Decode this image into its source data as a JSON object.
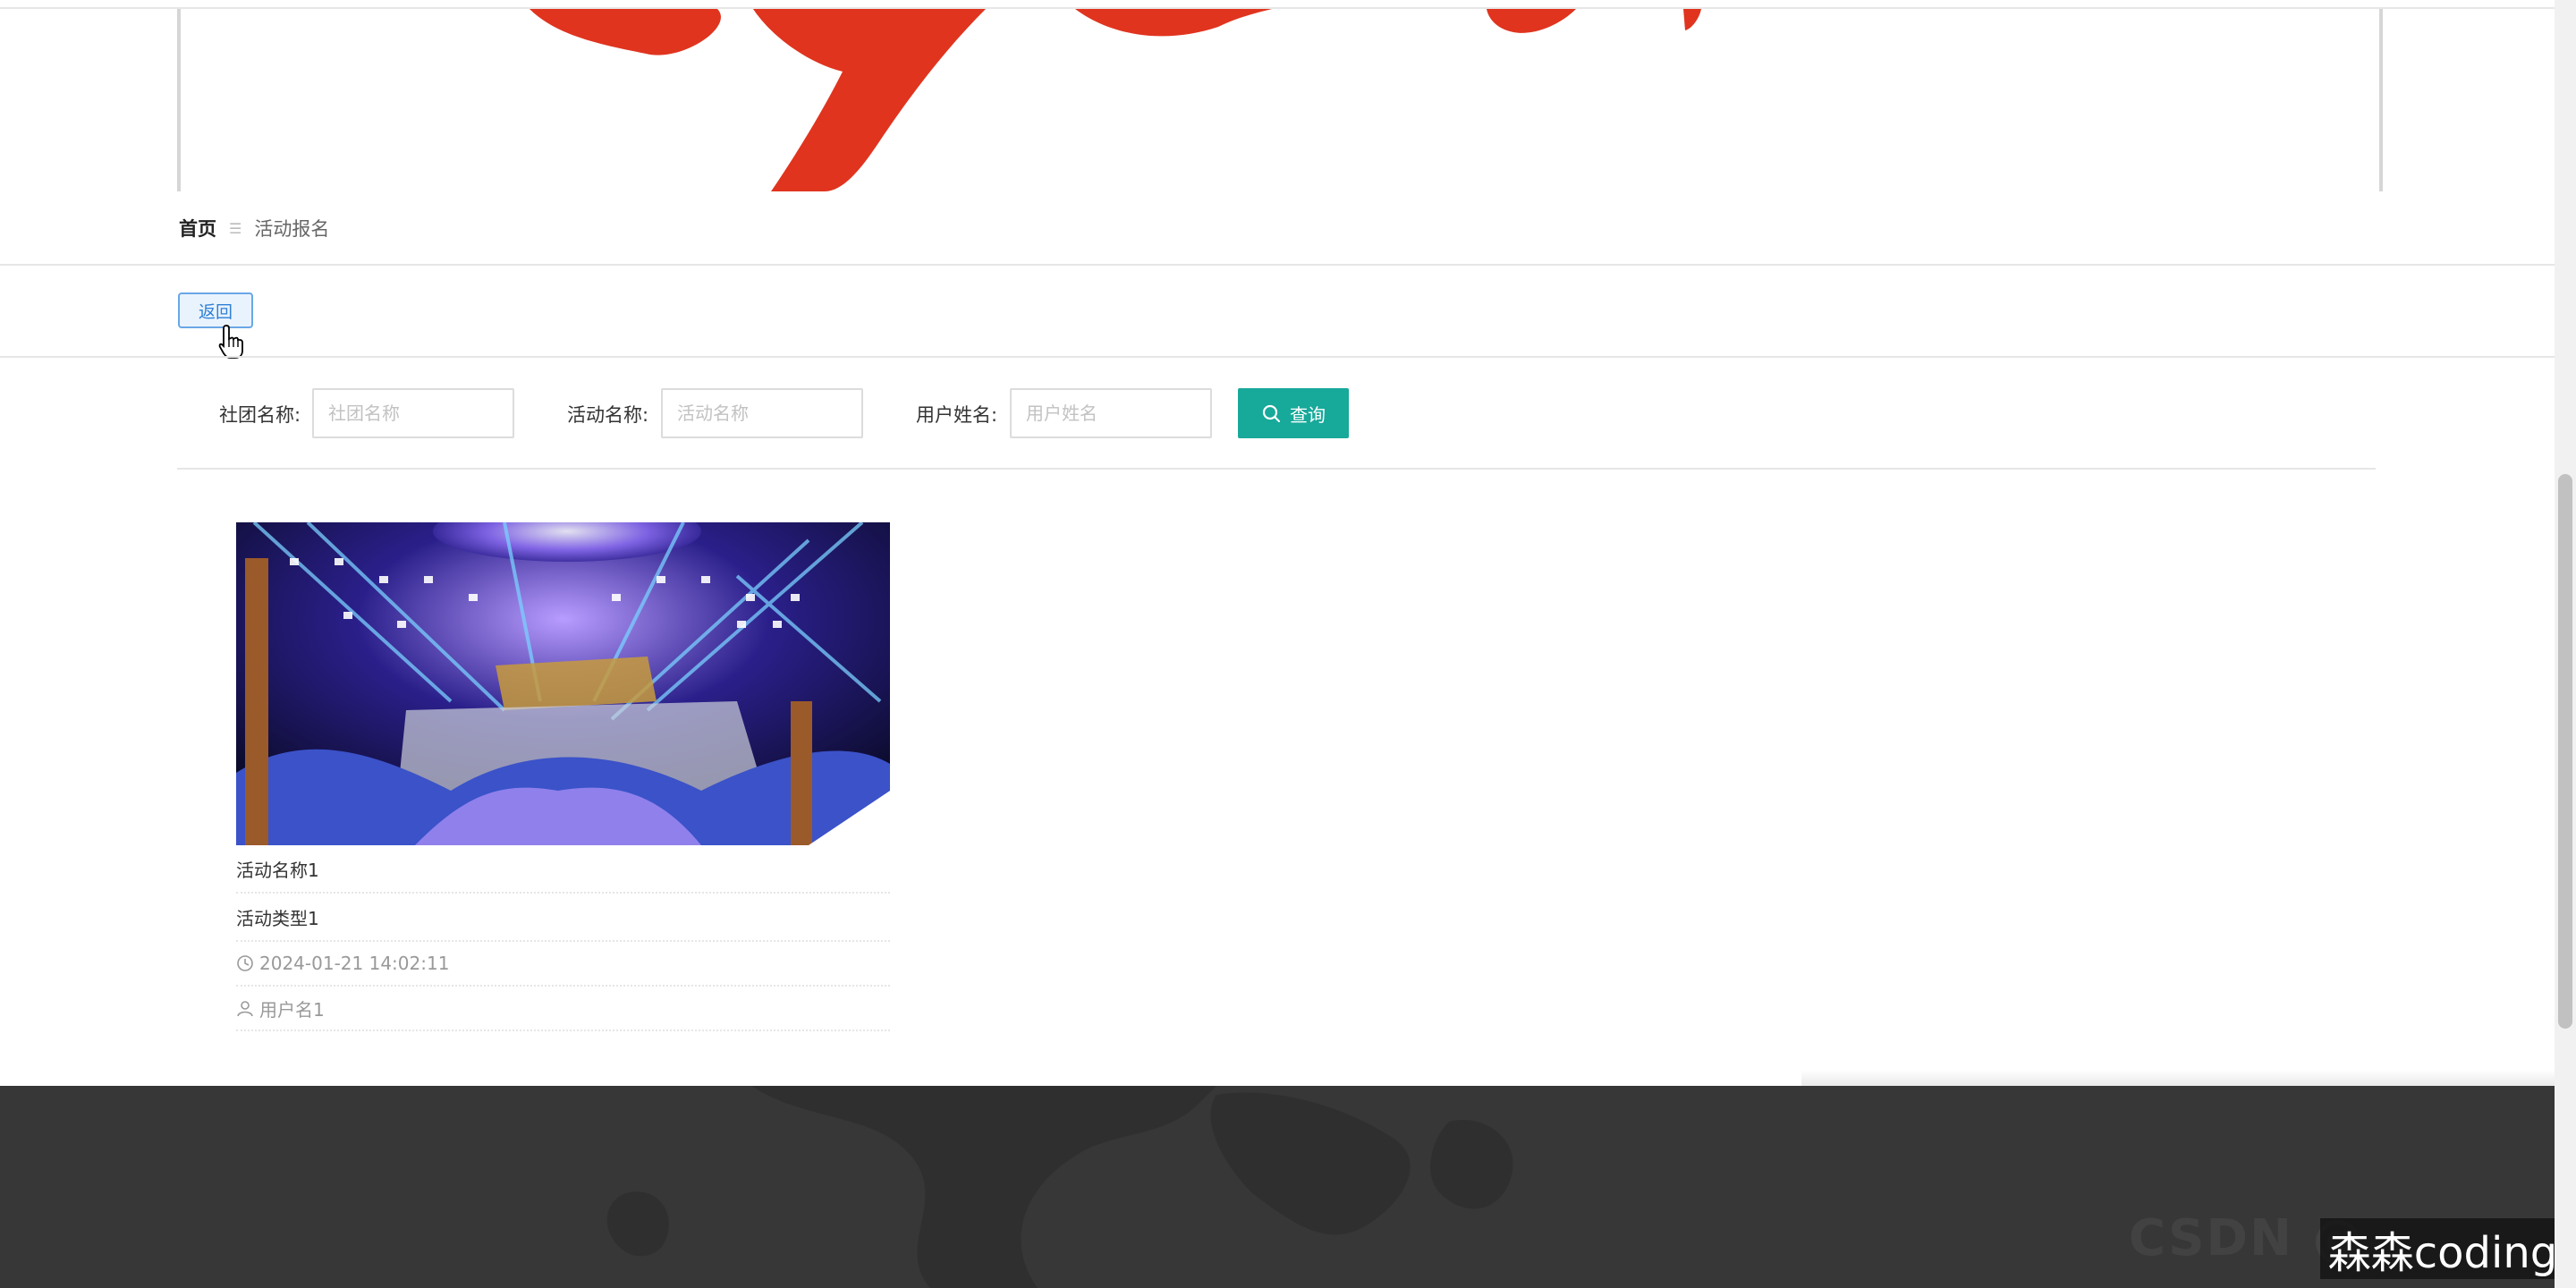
{
  "breadcrumb": {
    "home": "首页",
    "separator": "☰",
    "current": "活动报名"
  },
  "back_button": {
    "label": "返回"
  },
  "search": {
    "club_label": "社团名称:",
    "club_placeholder": "社团名称",
    "club_value": "",
    "activity_label": "活动名称:",
    "activity_placeholder": "活动名称",
    "activity_value": "",
    "user_label": "用户姓名:",
    "user_placeholder": "用户姓名",
    "user_value": "",
    "query_label": "查询"
  },
  "cards": [
    {
      "activity_name": "活动名称1",
      "activity_type": "活动类型1",
      "datetime": "2024-01-21 14:02:11",
      "username": "用户名1"
    }
  ],
  "watermark": {
    "text": "森森coding",
    "ghost_text": "CSDN @"
  },
  "colors": {
    "accent": "#17a99a",
    "back_button": "#2e7fd6",
    "footer": "#373737",
    "banner_red": "#e0341f"
  },
  "icons": {
    "search": "search-icon",
    "clock": "clock-icon",
    "user": "user-icon",
    "cursor": "hand-cursor-icon"
  }
}
